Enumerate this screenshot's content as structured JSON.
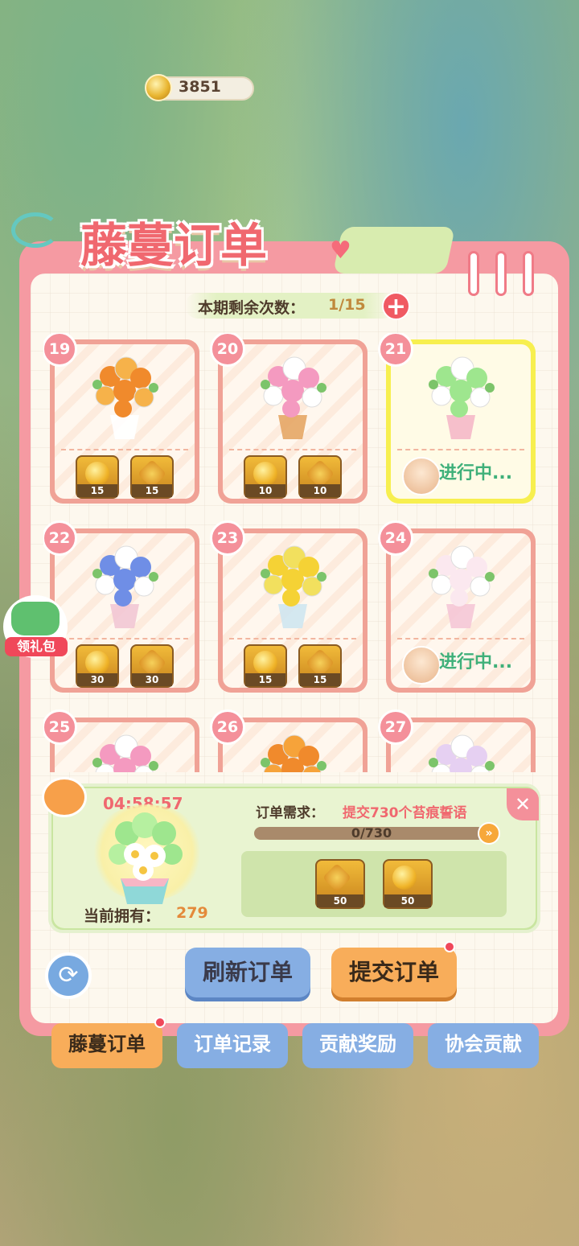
{
  "currency": {
    "amount": "3851",
    "icon": "coin-icon"
  },
  "panel": {
    "title": "藤蔓订单"
  },
  "remaining": {
    "label": "本期剩余次数：",
    "value": "1/15"
  },
  "orders": [
    {
      "num": "19",
      "flower": "orange-vase",
      "status": "rewards",
      "rewards": [
        {
          "icon": "coin",
          "qty": "15"
        },
        {
          "icon": "badge",
          "qty": "15"
        }
      ]
    },
    {
      "num": "20",
      "flower": "pink-basket",
      "status": "rewards",
      "rewards": [
        {
          "icon": "coin",
          "qty": "10"
        },
        {
          "icon": "badge",
          "qty": "10"
        }
      ]
    },
    {
      "num": "21",
      "flower": "green-pot",
      "status": "in-progress",
      "progress_label": "进行中..."
    },
    {
      "num": "22",
      "flower": "blue-box",
      "status": "rewards",
      "rewards": [
        {
          "icon": "coin",
          "qty": "30"
        },
        {
          "icon": "badge",
          "qty": "30"
        }
      ]
    },
    {
      "num": "23",
      "flower": "yellow-vase",
      "status": "rewards",
      "rewards": [
        {
          "icon": "coin",
          "qty": "15"
        },
        {
          "icon": "badge",
          "qty": "15"
        }
      ]
    },
    {
      "num": "24",
      "flower": "white-vase",
      "status": "in-progress",
      "progress_label": "进行中..."
    },
    {
      "num": "25",
      "flower": "pink-sprays"
    },
    {
      "num": "26",
      "flower": "orange-lilies"
    },
    {
      "num": "27",
      "flower": "lavender"
    }
  ],
  "detail": {
    "timer": "04:58:57",
    "owned_label": "当前拥有：",
    "owned_value": "279",
    "requirement_label": "订单需求：",
    "requirement_value": "提交730个苔痕誓语",
    "progress_text": "0/730",
    "progress": 0,
    "rewards": [
      {
        "icon": "badge",
        "qty": "50"
      },
      {
        "icon": "coin",
        "qty": "50"
      }
    ]
  },
  "buttons": {
    "refresh": "刷新订单",
    "submit": "提交订单"
  },
  "tabs": [
    {
      "label": "藤蔓订单",
      "active": true
    },
    {
      "label": "订单记录",
      "active": false
    },
    {
      "label": "贡献奖励",
      "active": false
    },
    {
      "label": "协会贡献",
      "active": false
    }
  ],
  "gift": {
    "label": "领礼包"
  },
  "colors": {
    "panel": "#f59aa2",
    "accent": "#f0686f",
    "inprogress": "#3fb07a",
    "tab_active": "#f8ad5a",
    "tab_inactive": "#86aee3"
  }
}
